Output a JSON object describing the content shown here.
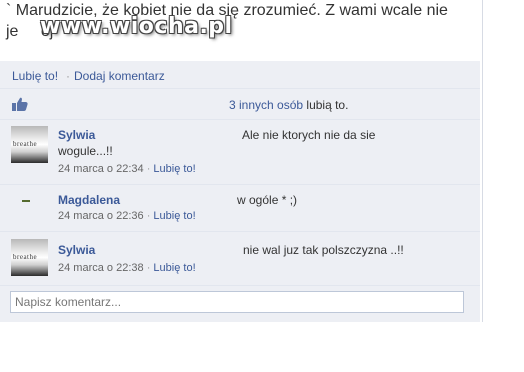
{
  "post": {
    "text": "` Marudzicie, że kobiet nie da się zrozumieć. Z wami wcale nie\nje       ej",
    "watermark": "www.wiocha.pl"
  },
  "actions": {
    "like_label": "Lubię to!",
    "separator": "·",
    "comment_label": "Dodaj komentarz"
  },
  "likes": {
    "others_link": "3 innych osób",
    "suffix": " lubią to."
  },
  "comments": [
    {
      "author": "Sylwia",
      "text_line1": "Ale nie ktorych nie da sie",
      "text_line2": "wogule...!!",
      "time": "24 marca o 22:34",
      "separator": "·",
      "like_label": "Lubię to!",
      "avatar_word": "breathe"
    },
    {
      "author": "Magdalena",
      "text_line1": "w ogóle * ;)",
      "time": "24 marca o 22:36",
      "separator": "·",
      "like_label": "Lubię to!"
    },
    {
      "author": "Sylwia",
      "text_line1": "nie wal juz tak polszczyzna ..!!",
      "time": "24 marca o 22:38",
      "separator": "·",
      "like_label": "Lubię to!",
      "avatar_word": "breathe"
    }
  ],
  "comment_box": {
    "placeholder": "Napisz komentarz..."
  },
  "colors": {
    "link": "#3b5998",
    "panel": "#edeff4",
    "input_border": "#bdc7d8"
  }
}
